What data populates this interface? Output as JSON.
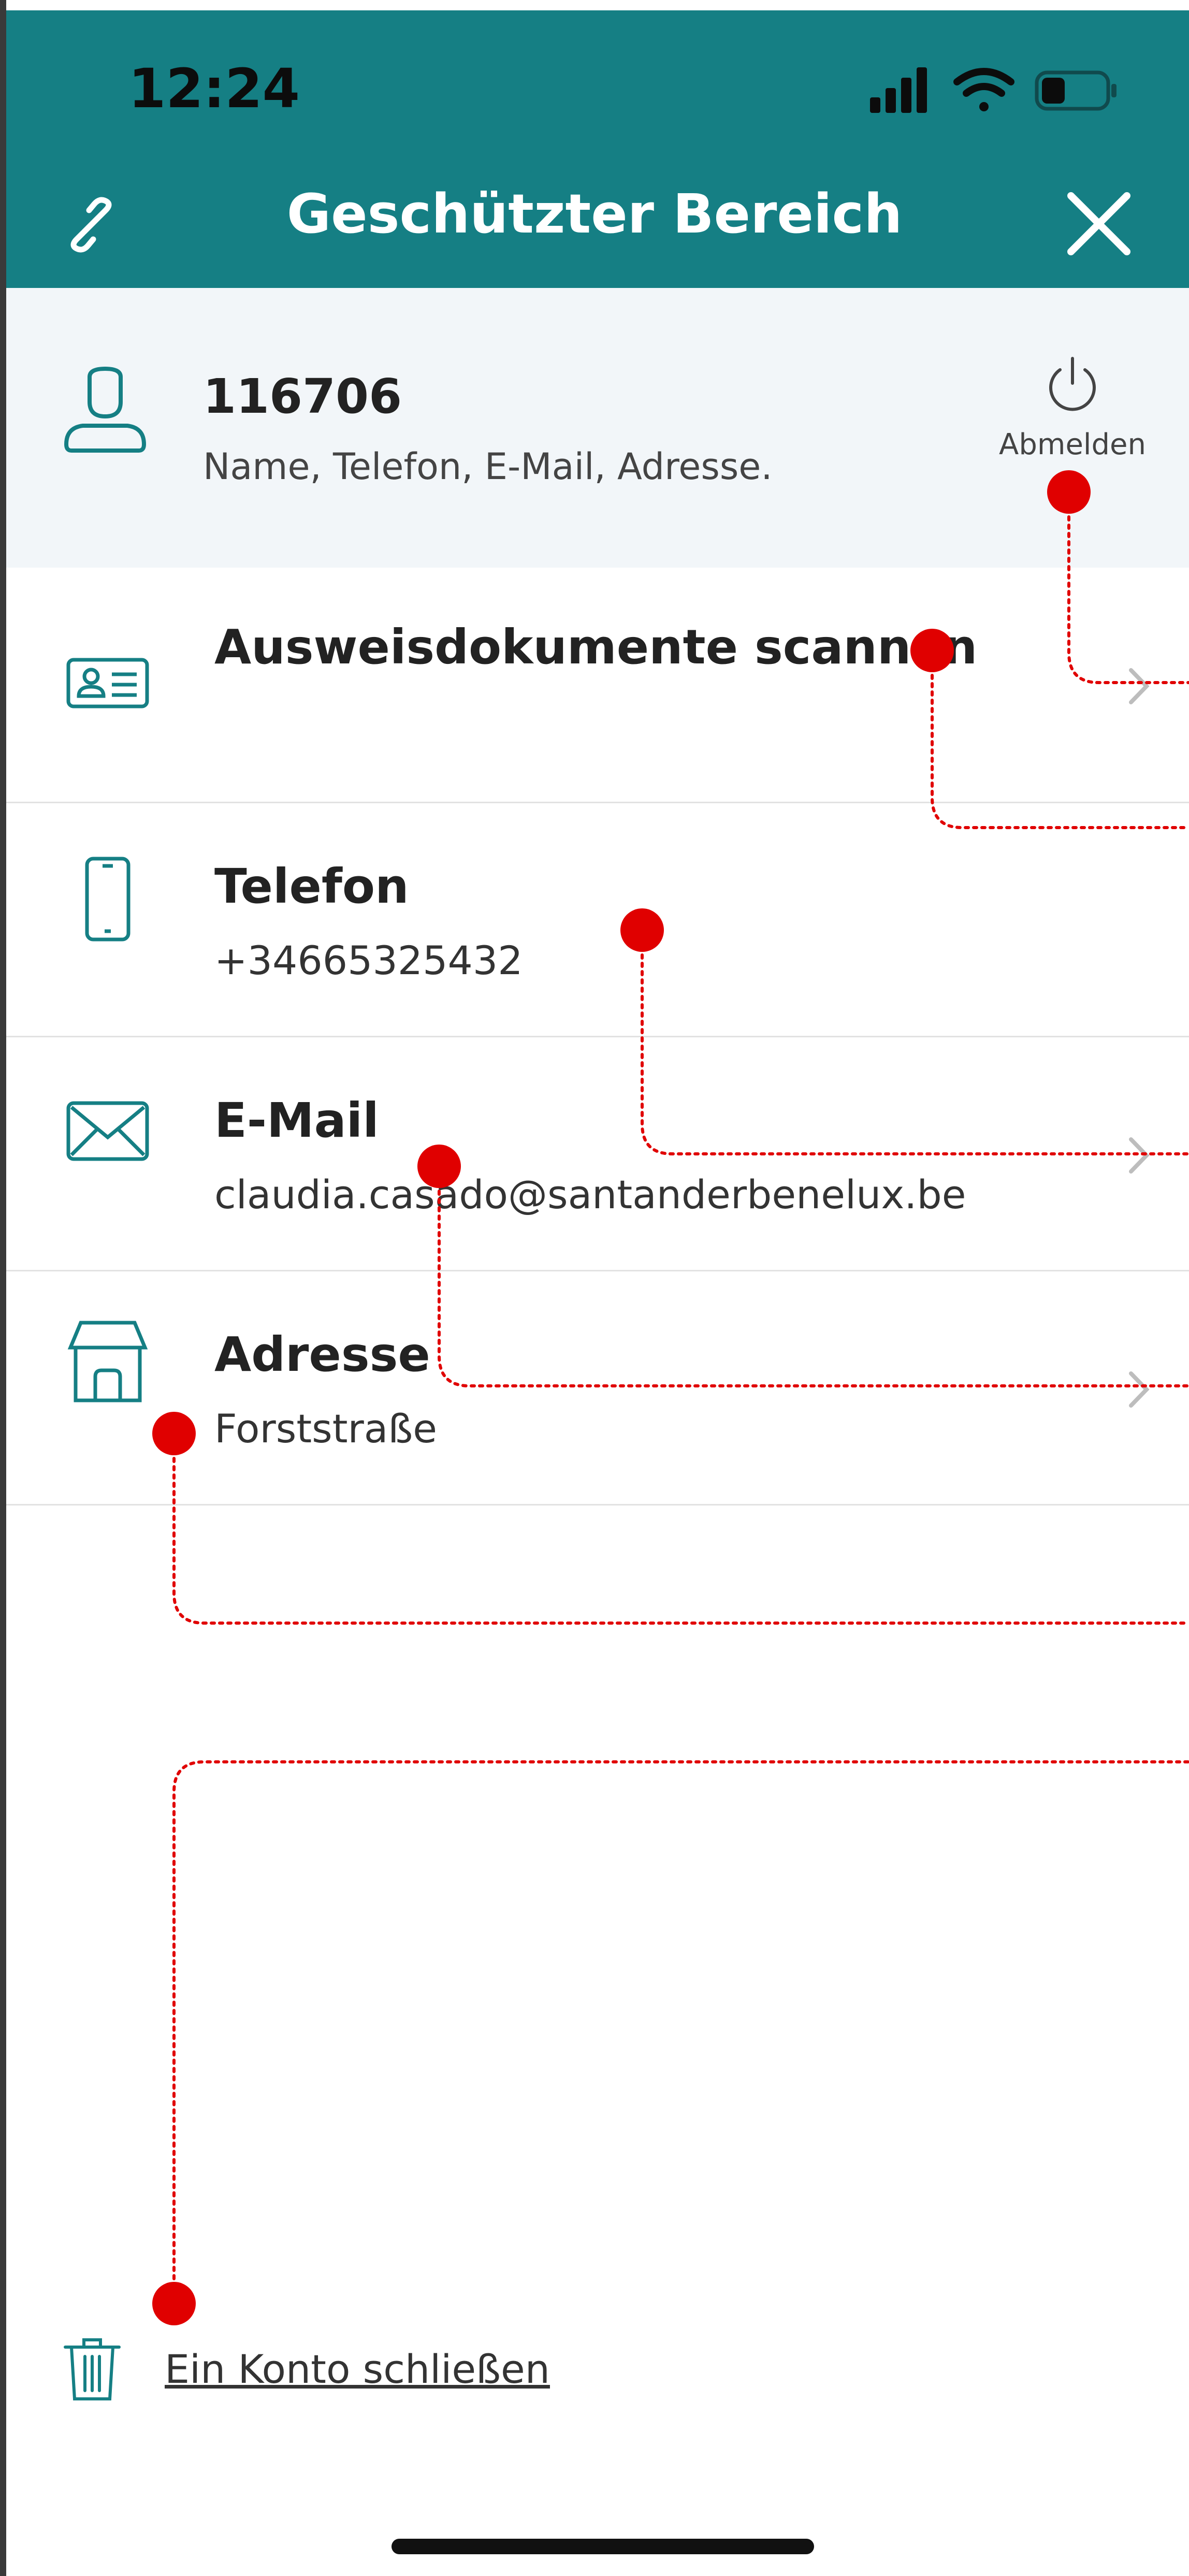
{
  "status_bar": {
    "time": "12:24"
  },
  "header": {
    "title": "Geschützter Bereich"
  },
  "account": {
    "number": "116706",
    "subtitle": "Name, Telefon, E-Mail, Adresse.",
    "logout_label": "Abmelden"
  },
  "items": [
    {
      "title": "Ausweisdokumente scannen",
      "subtitle": "",
      "icon": "id-card-icon"
    },
    {
      "title": "Telefon",
      "subtitle": "+34665325432",
      "icon": "phone-icon"
    },
    {
      "title": "E-Mail",
      "subtitle": "claudia.casado@santanderbenelux.be",
      "icon": "mail-icon"
    },
    {
      "title": "Adresse",
      "subtitle": "Forststraße",
      "icon": "house-icon"
    }
  ],
  "footer": {
    "close_account_label": "Ein Konto schließen",
    "icon": "trash-icon"
  },
  "colors": {
    "brand_teal": "#157f84",
    "annotation_red": "#e00000",
    "account_bg": "#f2f6f9"
  }
}
